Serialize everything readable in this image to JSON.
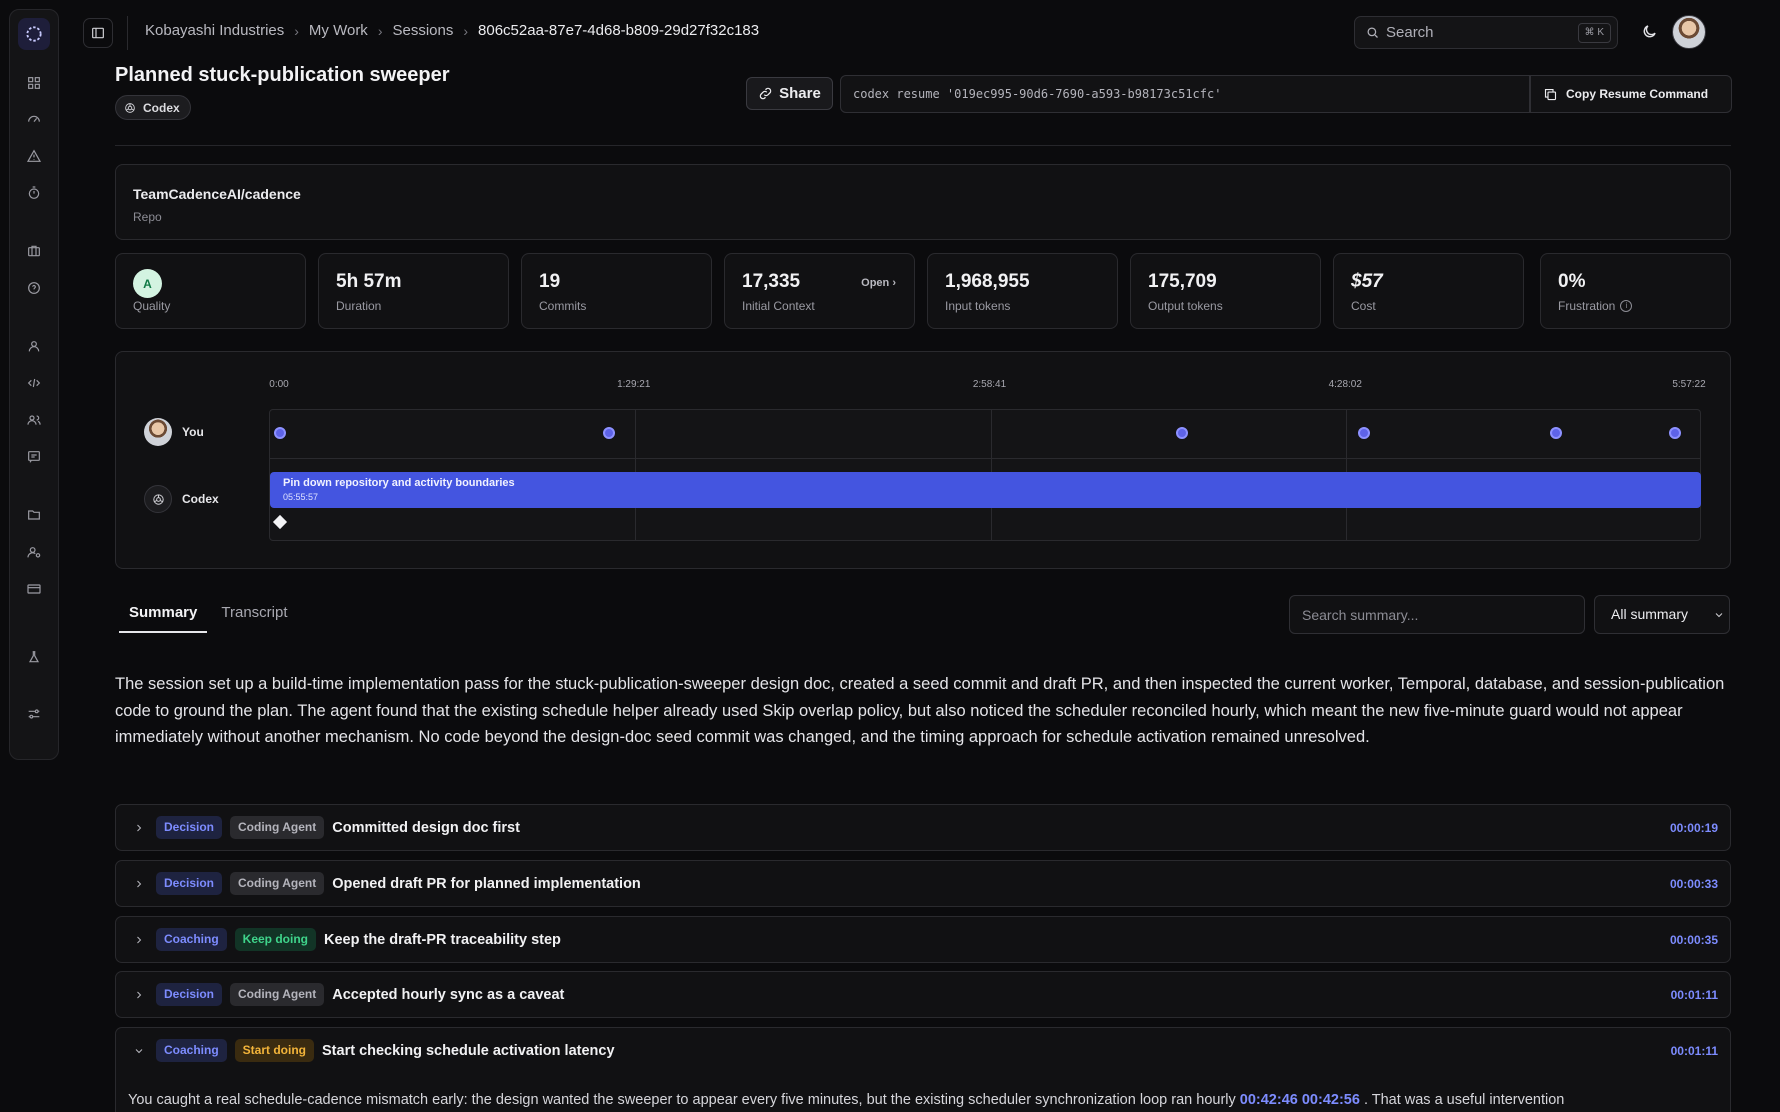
{
  "breadcrumb": [
    "Kobayashi Industries",
    "My Work",
    "Sessions",
    "806c52aa-87e7-4d68-b809-29d27f32c183"
  ],
  "search": {
    "placeholder": "Search",
    "shortcut": "⌘ K"
  },
  "session": {
    "title": "Planned stuck-publication sweeper",
    "agent_badge": "Codex",
    "share_label": "Share",
    "resume_command": "codex resume '019ec995-90d6-7690-a593-b98173c51cfc'",
    "copy_label": "Copy Resume Command"
  },
  "repo": {
    "name": "TeamCadenceAI/cadence",
    "label": "Repo"
  },
  "stats": [
    {
      "value": "A",
      "label": "Quality"
    },
    {
      "value": "5h 57m",
      "label": "Duration"
    },
    {
      "value": "19",
      "label": "Commits"
    },
    {
      "value": "17,335",
      "label": "Initial Context",
      "action": "Open"
    },
    {
      "value": "1,968,955",
      "label": "Input tokens"
    },
    {
      "value": "175,709",
      "label": "Output tokens"
    },
    {
      "value": "$57",
      "label": "Cost"
    },
    {
      "value": "0%",
      "label": "Frustration"
    }
  ],
  "timeline": {
    "ticks": [
      "0:00",
      "1:29:21",
      "2:58:41",
      "4:28:02",
      "5:57:22"
    ],
    "total_seconds": 21442,
    "you_label": "You",
    "agent_label": "Codex",
    "you_events_fraction": [
      0.007,
      0.237,
      0.637,
      0.764,
      0.898,
      0.981
    ],
    "agent_task": {
      "title": "Pin down repository and activity boundaries",
      "duration": "05:55:57"
    }
  },
  "tabs": [
    {
      "label": "Summary",
      "active": true
    },
    {
      "label": "Transcript",
      "active": false
    }
  ],
  "summary_search": {
    "placeholder": "Search summary..."
  },
  "filter": {
    "selected": "All summary"
  },
  "summary_text": "The session set up a build-time implementation pass for the stuck-publication-sweeper design doc, created a seed commit and draft PR, and then inspected the current worker, Temporal, database, and session-publication code to ground the plan. The agent found that the existing schedule helper already used Skip overlap policy, but also noticed the scheduler reconciled hourly, which meant the new five-minute guard would not appear immediately without another mechanism. No code beyond the design-doc seed commit was changed, and the timing approach for schedule activation remained unresolved.",
  "items": [
    {
      "type": "Decision",
      "tag": "Coding Agent",
      "title": "Committed design doc first",
      "time": "00:00:19"
    },
    {
      "type": "Decision",
      "tag": "Coding Agent",
      "title": "Opened draft PR for planned implementation",
      "time": "00:00:33"
    },
    {
      "type": "Coaching",
      "tag": "Keep doing",
      "title": "Keep the draft-PR traceability step",
      "time": "00:00:35"
    },
    {
      "type": "Decision",
      "tag": "Coding Agent",
      "title": "Accepted hourly sync as a caveat",
      "time": "00:01:11"
    },
    {
      "type": "Coaching",
      "tag": "Start doing",
      "title": "Start checking schedule activation latency",
      "time": "00:01:11",
      "body_text": "You caught a real schedule-cadence mismatch early: the design wanted the sweeper to appear every five minutes, but the existing scheduler synchronization loop ran hourly",
      "refs": [
        "00:42:46",
        "00:42:56"
      ],
      "body_tail": ". That was a useful intervention"
    }
  ],
  "colors": {
    "accent": "#4455e0",
    "link": "#7d8cff",
    "keep": "#3fd48b",
    "start": "#f3b43a"
  }
}
